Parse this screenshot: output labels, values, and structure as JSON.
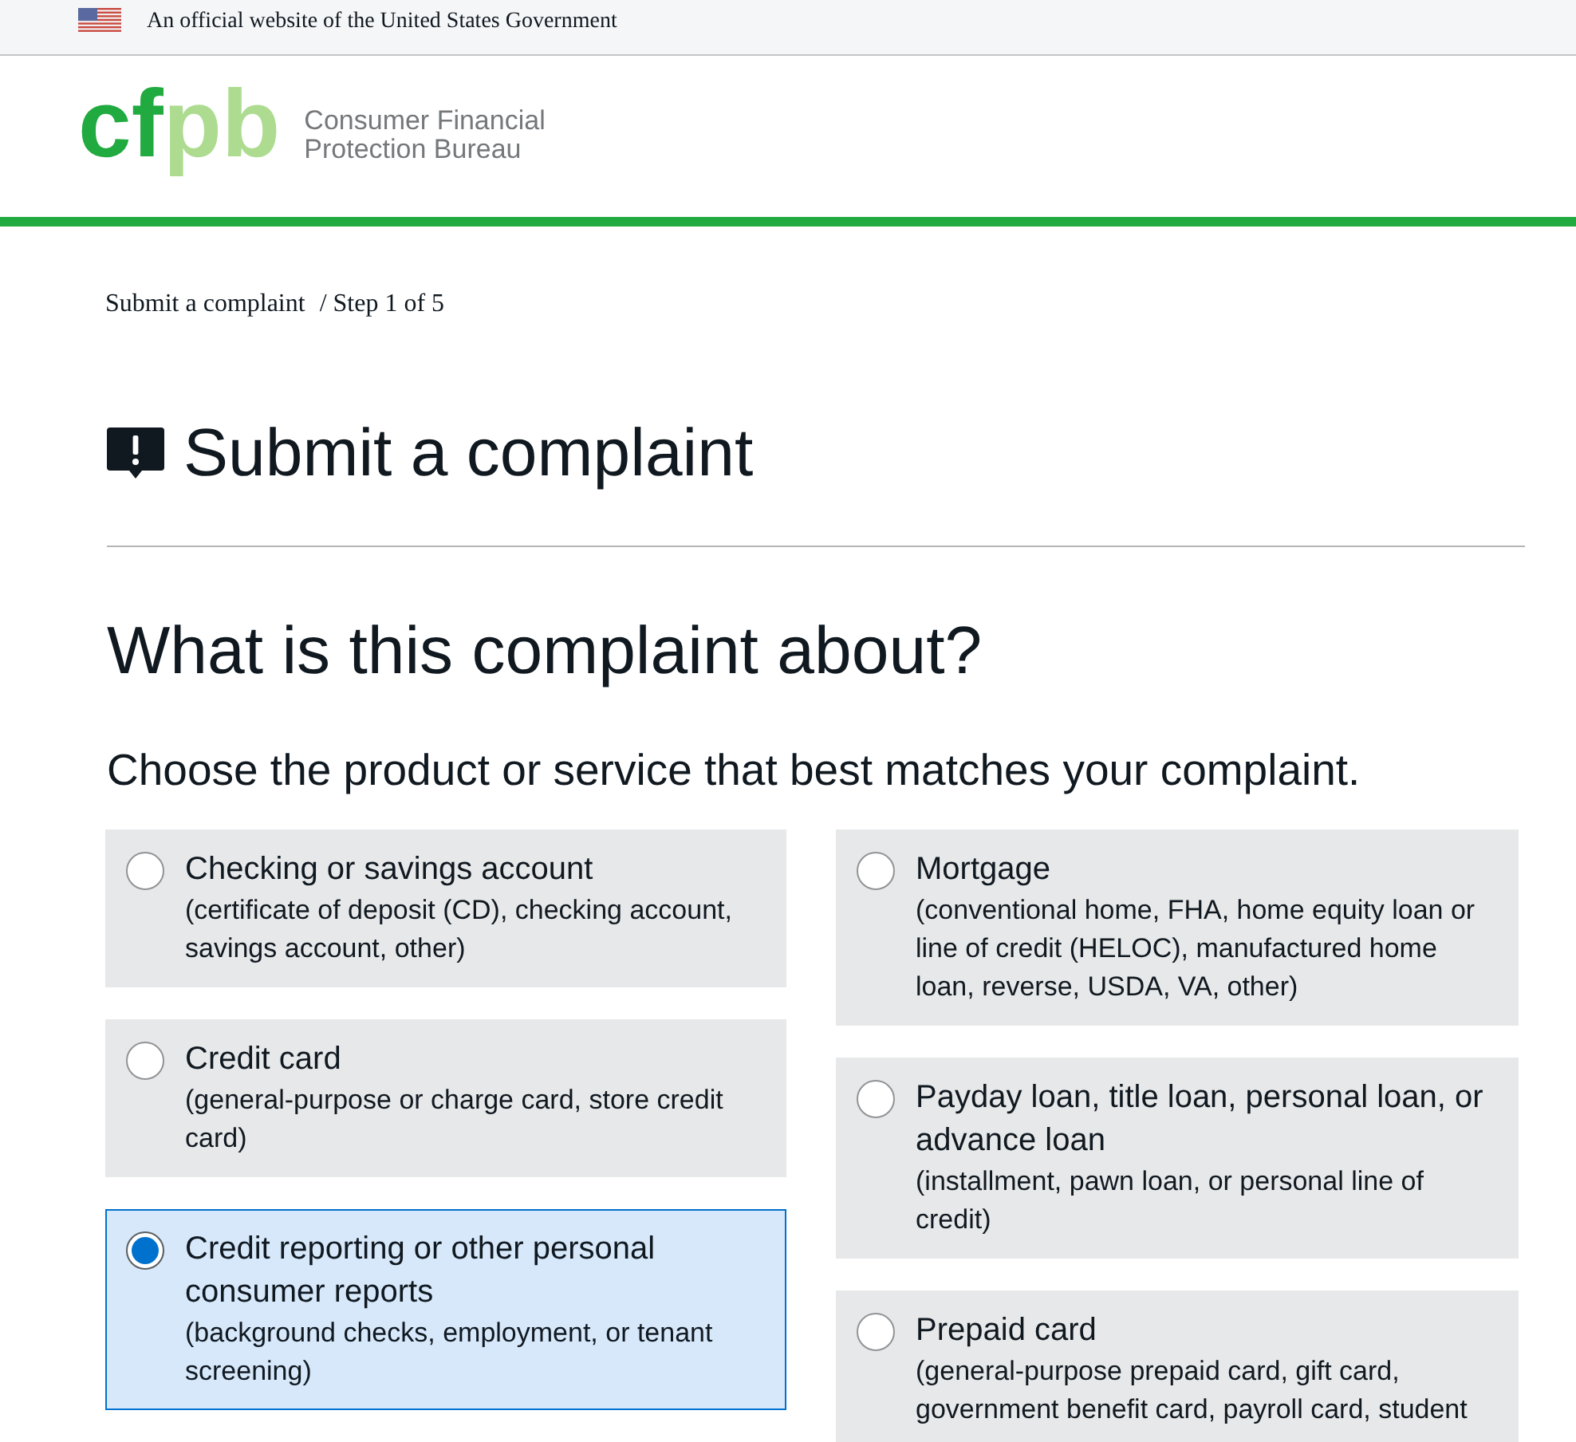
{
  "gov_banner": {
    "text": "An official website of the United States Government"
  },
  "header": {
    "logo_mark": "cfpb",
    "agency_name": [
      "Consumer Financial",
      "Protection Bureau"
    ]
  },
  "breadcrumb": {
    "current": "Submit a complaint",
    "step": "/ Step 1 of 5"
  },
  "page_title": "Submit a complaint",
  "question": {
    "heading": "What is this complaint about?",
    "prompt": "Choose the product or service that best matches your complaint."
  },
  "option_columns": [
    {
      "options": [
        {
          "title": "Checking or savings account",
          "description": "(certificate of deposit (CD), checking account, savings account, other)",
          "selected": false
        },
        {
          "title": "Credit card",
          "description": "(general-purpose or charge card, store credit card)",
          "selected": false
        },
        {
          "title": "Credit reporting or other personal consumer reports",
          "description": "(background checks, employment, or tenant screening)",
          "selected": true
        }
      ]
    },
    {
      "options": [
        {
          "title": "Mortgage",
          "description": "(conventional home, FHA, home equity loan or line of credit (HELOC), manufactured home loan, reverse, USDA, VA, other)",
          "selected": false
        },
        {
          "title": "Payday loan, title loan, personal loan, or advance loan",
          "description": "(installment, pawn loan, or personal line of credit)",
          "selected": false
        },
        {
          "title": "Prepaid card",
          "description": "(general-purpose prepaid card, gift card, government benefit card, payroll card, student",
          "selected": false
        }
      ]
    }
  ]
}
